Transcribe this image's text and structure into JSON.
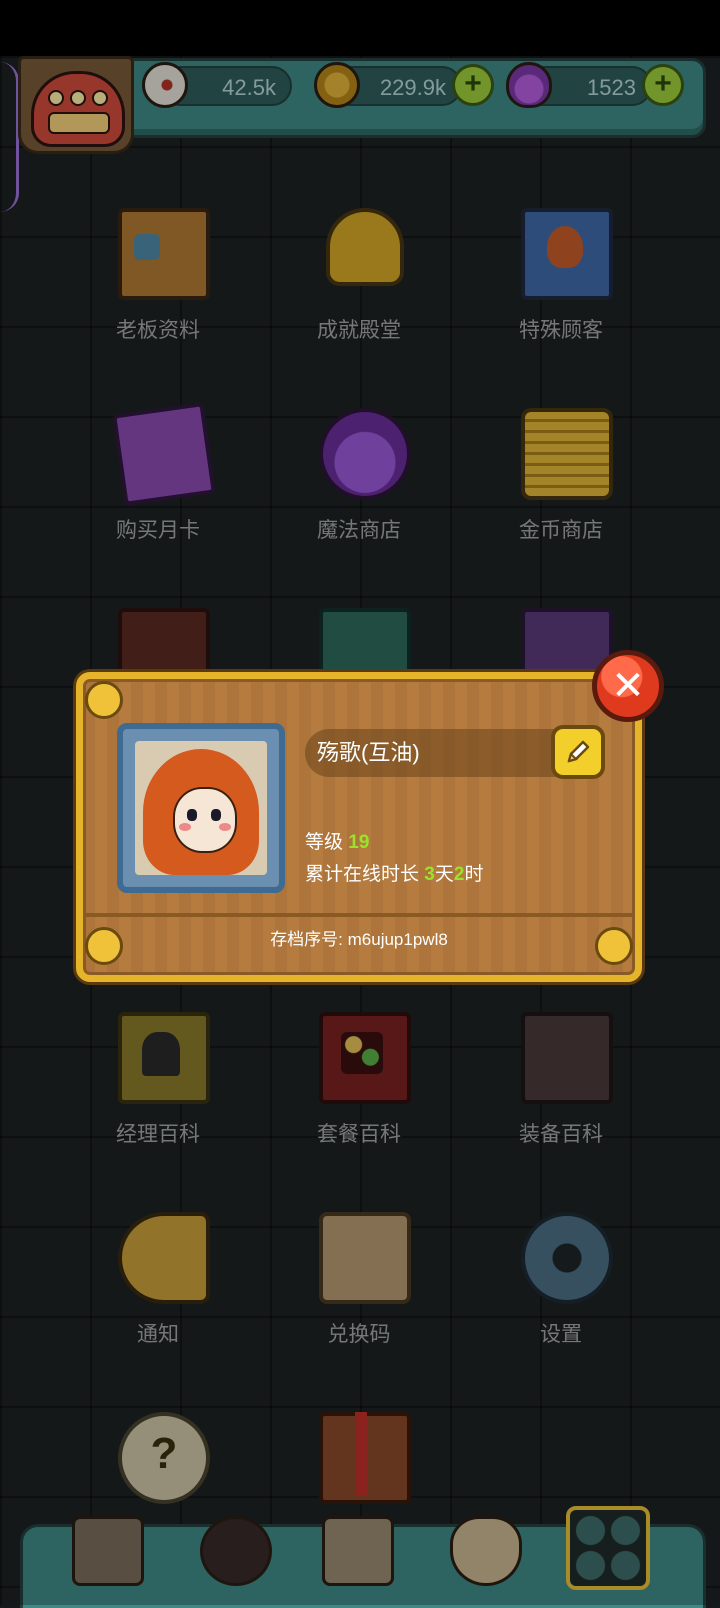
{
  "resources": {
    "eyes": "42.5k",
    "coins": "229.9k",
    "potions": "1523",
    "plus_symbol": "+"
  },
  "menu": [
    {
      "label": "老板资料",
      "icon": "boss-profile-card-icon"
    },
    {
      "label": "成就殿堂",
      "icon": "trophy-icon"
    },
    {
      "label": "特殊顾客",
      "icon": "special-customer-portrait-icon"
    },
    {
      "label": "购买月卡",
      "icon": "monthly-card-icon"
    },
    {
      "label": "魔法商店",
      "icon": "magic-potion-icon"
    },
    {
      "label": "金币商店",
      "icon": "gold-coins-icon"
    },
    {
      "label": "",
      "icon": "monster-book-icon"
    },
    {
      "label": "",
      "icon": "fishbone-book-icon"
    },
    {
      "label": "",
      "icon": "cloche-book-icon"
    },
    {
      "label": "经理百科",
      "icon": "manager-book-icon"
    },
    {
      "label": "套餐百科",
      "icon": "meal-book-icon"
    },
    {
      "label": "装备百科",
      "icon": "equipment-book-icon"
    },
    {
      "label": "通知",
      "icon": "horn-icon"
    },
    {
      "label": "兑换码",
      "icon": "scroll-icon"
    },
    {
      "label": "设置",
      "icon": "gear-icon"
    },
    {
      "label": "",
      "icon": "help-icon",
      "text": "?"
    },
    {
      "label": "",
      "icon": "gift-icon"
    }
  ],
  "profile": {
    "name": "殇歌(互油)",
    "level_label": "等级",
    "level": "19",
    "online_label": "累计在线时长",
    "online_days": "3",
    "days_unit": "天",
    "online_hours": "2",
    "hours_unit": "时",
    "save_id": "存档序号: m6ujup1pwl8",
    "close_symbol": "✕"
  },
  "bottom_nav": [
    "shop-icon",
    "monster-icon",
    "book-icon",
    "coin-bag-icon",
    "grid-menu-icon"
  ],
  "colors": {
    "background": "#1d2223",
    "teal_bar": "#3f8a86",
    "dialog_wood": "#b67b3e",
    "dialog_border": "#e6b42a",
    "highlight_green": "#9be22a",
    "close_red": "#e03a1e"
  }
}
